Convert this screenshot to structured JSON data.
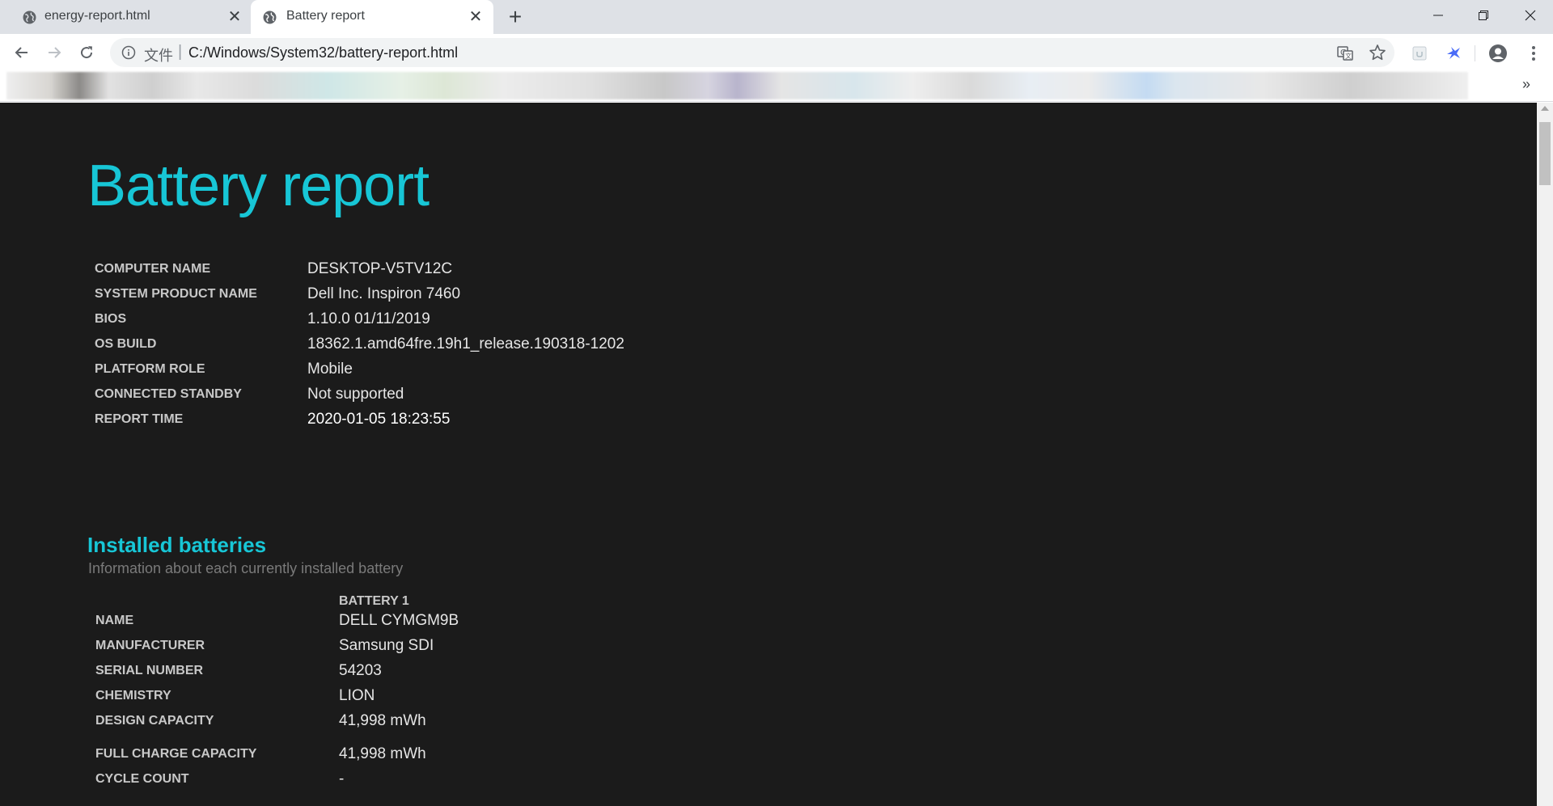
{
  "browser": {
    "tabs": [
      {
        "label": "energy-report.html",
        "active": false
      },
      {
        "label": "Battery report",
        "active": true
      }
    ],
    "new_tab_glyph": "+",
    "close_glyph": "✕",
    "address": {
      "scheme_label": "文件",
      "separator": "|",
      "url": "C:/Windows/System32/battery-report.html"
    },
    "bookmarks_overflow": "»",
    "icons": [
      "globe-icon",
      "back-arrow-icon",
      "forward-arrow-icon",
      "reload-icon",
      "info-icon",
      "translate-icon",
      "star-icon",
      "extension-icon",
      "profile-icon",
      "menu-dots-icon",
      "minimize-icon",
      "maximize-icon",
      "close-icon"
    ]
  },
  "report": {
    "title": "Battery report",
    "system_info": [
      {
        "label": "COMPUTER NAME",
        "value": "DESKTOP-V5TV12C"
      },
      {
        "label": "SYSTEM PRODUCT NAME",
        "value": "Dell Inc. Inspiron 7460"
      },
      {
        "label": "BIOS",
        "value": "1.10.0 01/11/2019"
      },
      {
        "label": "OS BUILD",
        "value": "18362.1.amd64fre.19h1_release.190318-1202"
      },
      {
        "label": "PLATFORM ROLE",
        "value": "Mobile"
      },
      {
        "label": "CONNECTED STANDBY",
        "value": "Not supported"
      },
      {
        "label": "REPORT TIME",
        "value": "2020-01-05  18:23:55"
      }
    ],
    "installed_batteries": {
      "title": "Installed batteries",
      "subtitle": "Information about each currently installed battery",
      "column_header": "BATTERY 1",
      "rows": [
        {
          "label": "NAME",
          "value": "DELL CYMGM9B"
        },
        {
          "label": "MANUFACTURER",
          "value": "Samsung SDI"
        },
        {
          "label": "SERIAL NUMBER",
          "value": "54203"
        },
        {
          "label": "CHEMISTRY",
          "value": "LION"
        },
        {
          "label": "DESIGN CAPACITY",
          "value": "41,998 mWh"
        },
        {
          "label": "FULL CHARGE CAPACITY",
          "value": "41,998 mWh"
        },
        {
          "label": "CYCLE COUNT",
          "value": "-"
        }
      ]
    }
  },
  "colors": {
    "accent": "#17c6d6",
    "page_background": "#1b1b1b",
    "tabstrip": "#dee1e6"
  }
}
